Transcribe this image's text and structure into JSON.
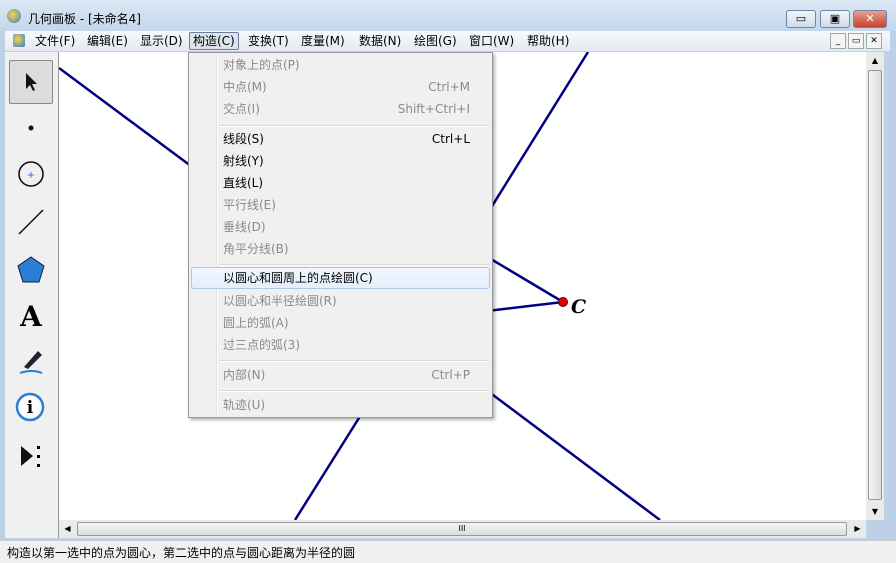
{
  "window": {
    "title": "几何画板 - [未命名4]",
    "min": "▭",
    "max": "▣",
    "close": "✕"
  },
  "menubar": [
    "文件(F)",
    "编辑(E)",
    "显示(D)",
    "构造(C)",
    "变换(T)",
    "度量(M)",
    "数据(N)",
    "绘图(G)",
    "窗口(W)",
    "帮助(H)"
  ],
  "construct_menu": {
    "items": [
      {
        "label": "对象上的点(P)",
        "shortcut": "",
        "enabled": false
      },
      {
        "label": "中点(M)",
        "shortcut": "Ctrl+M",
        "enabled": false
      },
      {
        "label": "交点(I)",
        "shortcut": "Shift+Ctrl+I",
        "enabled": false
      },
      {
        "label": "线段(S)",
        "shortcut": "Ctrl+L",
        "enabled": true
      },
      {
        "label": "射线(Y)",
        "shortcut": "",
        "enabled": true
      },
      {
        "label": "直线(L)",
        "shortcut": "",
        "enabled": true
      },
      {
        "label": "平行线(E)",
        "shortcut": "",
        "enabled": false
      },
      {
        "label": "垂线(D)",
        "shortcut": "",
        "enabled": false
      },
      {
        "label": "角平分线(B)",
        "shortcut": "",
        "enabled": false
      },
      {
        "label": "以圆心和圆周上的点绘圆(C)",
        "shortcut": "",
        "enabled": true,
        "highlighted": true
      },
      {
        "label": "以圆心和半径绘圆(R)",
        "shortcut": "",
        "enabled": false
      },
      {
        "label": "圆上的弧(A)",
        "shortcut": "",
        "enabled": false
      },
      {
        "label": "过三点的弧(3)",
        "shortcut": "",
        "enabled": false
      },
      {
        "label": "内部(N)",
        "shortcut": "Ctrl+P",
        "enabled": false
      },
      {
        "label": "轨迹(U)",
        "shortcut": "",
        "enabled": false
      }
    ]
  },
  "canvas": {
    "point_label": "C",
    "line_color": "#000080",
    "point_color": "#e00000"
  },
  "hscroll_grip": "III",
  "status": "构造以第一选中的点为圆心，第二选中的点与圆心距离为半径的圆"
}
